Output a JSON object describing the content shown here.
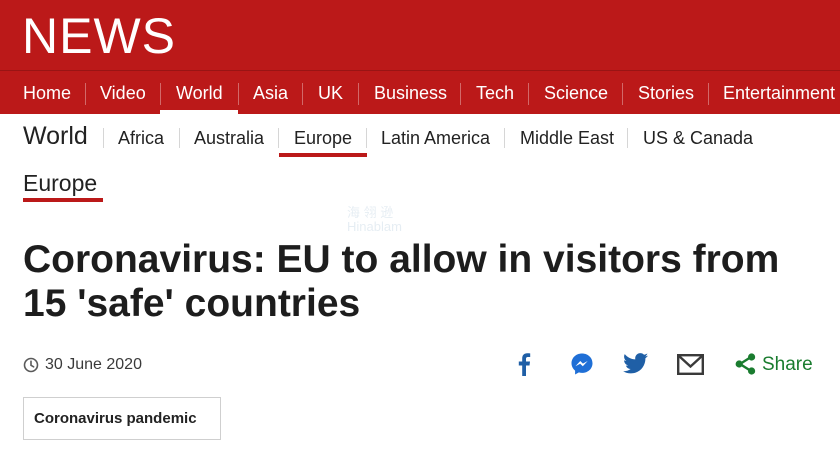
{
  "brand": {
    "logo_text": "NEWS"
  },
  "main_nav": {
    "items": [
      "Home",
      "Video",
      "World",
      "Asia",
      "UK",
      "Business",
      "Tech",
      "Science",
      "Stories",
      "Entertainment &"
    ],
    "active": "World"
  },
  "sub_nav": {
    "section_title": "World",
    "items": [
      "Africa",
      "Australia",
      "Europe",
      "Latin America",
      "Middle East",
      "US & Canada"
    ],
    "active": "Europe"
  },
  "section_tag": "Europe",
  "article": {
    "headline": "Coronavirus: EU to allow in visitors from 15 'safe' countries",
    "date": "30 June 2020"
  },
  "share": {
    "icons": [
      "facebook-icon",
      "messenger-icon",
      "twitter-icon",
      "email-icon",
      "share-icon"
    ],
    "label": "Share"
  },
  "topic": {
    "label": "Coronavirus pandemic"
  },
  "watermark": {
    "line1": "海 翎 逊",
    "line2": "Hinablam"
  },
  "colors": {
    "brand_red": "#bb1919",
    "share_green": "#1a7c2f",
    "social_blue": "#1f5fa6"
  }
}
